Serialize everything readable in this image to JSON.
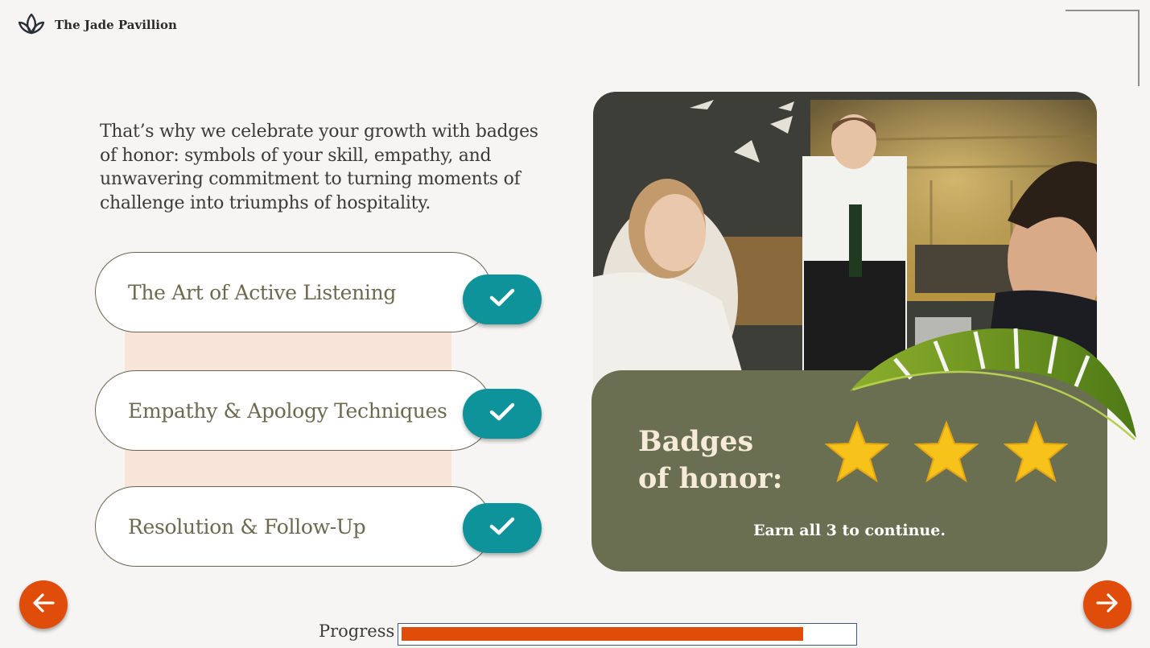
{
  "header": {
    "brand": "The Jade Pavillion",
    "logo_icon": "lotus-icon"
  },
  "intro_text": "That’s why we celebrate your growth with badges of honor: symbols of your skill, empathy, and unwavering commitment to turning moments of challenge into triumphs of hospitality.",
  "modules": [
    {
      "label": "The Art of Active Listening",
      "status_icon": "checkmark-icon",
      "completed": true
    },
    {
      "label": "Empathy & Apology Techniques",
      "status_icon": "checkmark-icon",
      "completed": true
    },
    {
      "label": "Resolution & Follow-Up",
      "status_icon": "checkmark-icon",
      "completed": true
    }
  ],
  "badges": {
    "title_line1": "Badges",
    "title_line2": "of honor:",
    "earned": 3,
    "total": 3,
    "caption": "Earn all 3 to continue."
  },
  "navigation": {
    "prev_icon": "arrow-left-icon",
    "next_icon": "arrow-right-icon"
  },
  "progress": {
    "label": "Progress",
    "value": 0.89
  },
  "colors": {
    "accent_orange": "#e04d0a",
    "teal": "#0f939b",
    "olive_card": "#6b6f52",
    "band_peach": "#f8e4d8",
    "star_gold": "#f7c21a"
  }
}
